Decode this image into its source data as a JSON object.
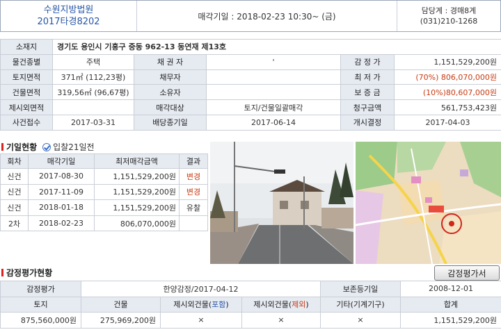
{
  "header": {
    "court": "수원지방법원",
    "case_no": "2017타경8202",
    "sale_date": "매각기일 : 2018-02-23   10:30~ (금)",
    "dept": "담당계 : 경매8계",
    "phone": "(031)210-1268"
  },
  "info": {
    "address_label": "소재지",
    "address": "경기도 용인시 기흥구 중동 962-13 동연재 제13호",
    "type_label": "물건종별",
    "type": "주택",
    "creditor_label": "채 권 자",
    "creditor": "'",
    "appraisal_label": "감 정 가",
    "appraisal": "1,151,529,200원",
    "land_label": "토지면적",
    "land": "371㎡ (112,23평)",
    "debtor_label": "채무자",
    "debtor": "",
    "min_price_label": "최 저 가",
    "min_price": "(70%) 806,070,000원",
    "bldg_label": "건물면적",
    "bldg": "319,56㎡ (96,67평)",
    "owner_label": "소유자",
    "owner": "",
    "deposit_label": "보 증 금",
    "deposit": "(10%)80,607,000원",
    "excl_label": "제시외면적",
    "excl": "",
    "target_label": "매각대상",
    "target": "토지/건물일괄매각",
    "claim_label": "청구금액",
    "claim": "561,753,423원",
    "receipt_label": "사건접수",
    "receipt": "2017-03-31",
    "div_label": "배당종기일",
    "div": "2017-06-14",
    "start_label": "개시결정",
    "start": "2017-04-03"
  },
  "history": {
    "title": "기일현황",
    "badge": "입찰21일전",
    "columns": [
      "회차",
      "매각기일",
      "최저매각금액",
      "결과"
    ],
    "rows": [
      {
        "round": "신건",
        "date": "2017-08-30",
        "amount": "1,151,529,200원",
        "result": "변경",
        "red": true
      },
      {
        "round": "신건",
        "date": "2017-11-09",
        "amount": "1,151,529,200원",
        "result": "변경",
        "red": true
      },
      {
        "round": "신건",
        "date": "2018-01-18",
        "amount": "1,151,529,200원",
        "result": "유찰",
        "red": false
      },
      {
        "round": "2차",
        "date": "2018-02-23",
        "amount": "806,070,000원",
        "result": "",
        "red": false
      }
    ]
  },
  "appraisal": {
    "title": "감정평가현황",
    "button": "감정평가서",
    "label": "감정평가",
    "org": "한양감정/2017-04-12",
    "keep_label": "보존등기일",
    "keep": "2008-12-01",
    "cols": {
      "land": "토지",
      "bldg": "건물",
      "excl_incl_prefix": "제시외건물(",
      "excl_incl_mid": "포함",
      "excl_excl_mid": "제외",
      "suffix": ")",
      "other": "기타(기계기구)",
      "total": "합계"
    },
    "values": {
      "land": "875,560,000원",
      "bldg": "275,969,200원",
      "excl_incl": "×",
      "excl_excl": "×",
      "other": "×",
      "total": "1,151,529,200원"
    }
  },
  "colors": {
    "accent_blue": "#2756a6",
    "accent_red": "#c83c14",
    "label_bg": "#e6ebf2"
  }
}
